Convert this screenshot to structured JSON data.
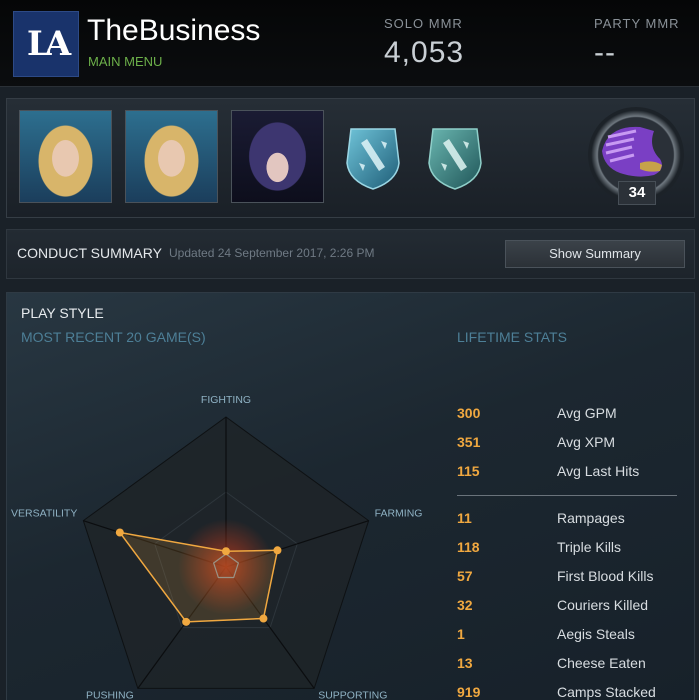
{
  "header": {
    "logo_text": "LA",
    "player_name": "TheBusiness",
    "subtitle": "MAIN MENU",
    "solo_mmr_label": "SOLO MMR",
    "solo_mmr_value": "4,053",
    "party_mmr_label": "PARTY MMR",
    "party_mmr_value": "--"
  },
  "hero_bar": {
    "portraits": [
      "hero-portrait-crystal-maiden",
      "hero-portrait-crystal-maiden",
      "hero-portrait-luna"
    ],
    "shields": [
      "dota-logo-shield-icon",
      "dota-logo-shield-icon"
    ],
    "medal": {
      "icon": "boots-medal-icon",
      "level": "34"
    }
  },
  "conduct": {
    "title": "CONDUCT SUMMARY",
    "updated": "Updated 24 September 2017, 2:26 PM",
    "button": "Show Summary"
  },
  "playstyle": {
    "title": "PLAY STYLE",
    "recent": "MOST RECENT 20 GAME(S)",
    "lifetime": "LIFETIME STATS",
    "axes": [
      "FIGHTING",
      "FARMING",
      "SUPPORTING",
      "PUSHING",
      "VERSATILITY"
    ],
    "radar_values": [
      0.02,
      0.3,
      0.37,
      0.4,
      0.72
    ],
    "accent": "#f0a840",
    "stats_top": [
      {
        "value": "300",
        "label": "Avg GPM"
      },
      {
        "value": "351",
        "label": "Avg XPM"
      },
      {
        "value": "115",
        "label": "Avg Last Hits"
      }
    ],
    "stats_bottom": [
      {
        "value": "11",
        "label": "Rampages"
      },
      {
        "value": "118",
        "label": "Triple Kills"
      },
      {
        "value": "57",
        "label": "First Blood Kills"
      },
      {
        "value": "32",
        "label": "Couriers Killed"
      },
      {
        "value": "1",
        "label": "Aegis Steals"
      },
      {
        "value": "13",
        "label": "Cheese Eaten"
      },
      {
        "value": "919",
        "label": "Camps Stacked"
      }
    ]
  }
}
